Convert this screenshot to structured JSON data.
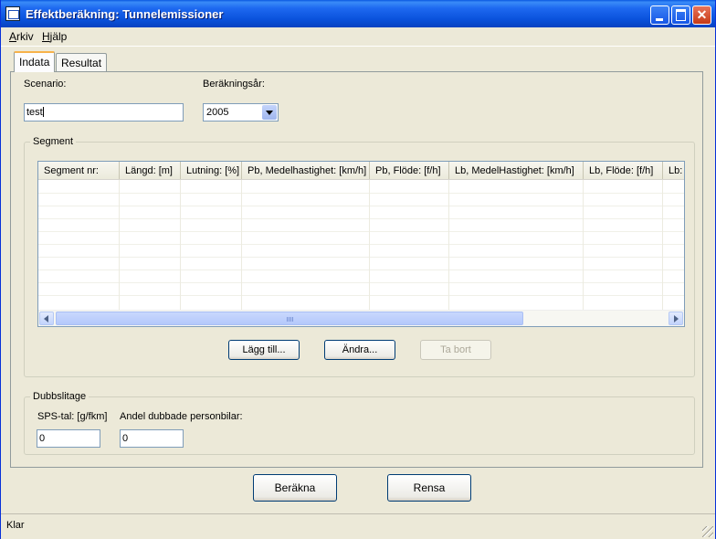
{
  "window": {
    "title": "Effektberäkning: Tunnelemissioner"
  },
  "menu": {
    "items": [
      {
        "label": "rkiv",
        "accel": "A"
      },
      {
        "label": "jälp",
        "accel": "H"
      }
    ]
  },
  "tabs": [
    {
      "label": "Indata",
      "active": true
    },
    {
      "label": "Resultat",
      "active": false
    }
  ],
  "form": {
    "scenario_label": "Scenario:",
    "scenario_value": "test",
    "year_label": "Beräkningsår:",
    "year_value": "2005"
  },
  "segment": {
    "group_title": "Segment",
    "columns": [
      "Segment nr:",
      "Längd: [m]",
      "Lutning: [%]",
      "Pb, Medelhastighet: [km/h]",
      "Pb, Flöde: [f/h]",
      "Lb, MedelHastighet: [km/h]",
      "Lb, Flöde: [f/h]",
      "Lb:"
    ],
    "rows": [],
    "buttons": {
      "add": "Lägg till...",
      "edit": "Ändra...",
      "delete": "Ta bort"
    }
  },
  "dubbslitage": {
    "group_title": "Dubbslitage",
    "sps_label": "SPS-tal: [g/fkm]",
    "sps_value": "0",
    "andel_label": "Andel dubbade personbilar:",
    "andel_value": "0"
  },
  "actions": {
    "calculate": "Beräkna",
    "clear": "Rensa"
  },
  "status": {
    "text": "Klar"
  }
}
